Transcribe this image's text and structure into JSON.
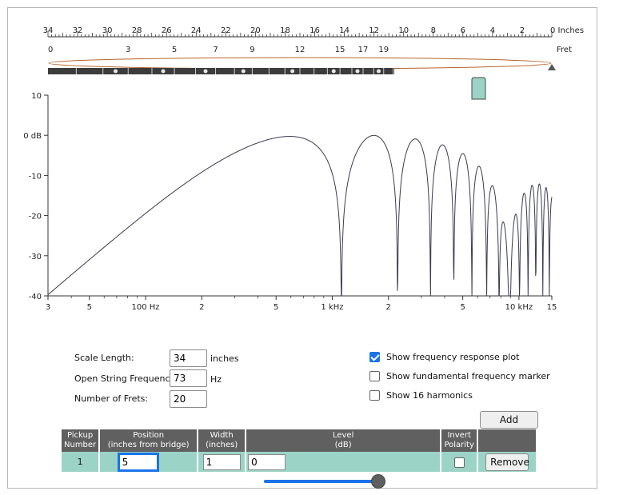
{
  "ruler": {
    "inch_labels": [
      "34",
      "32",
      "30",
      "28",
      "26",
      "24",
      "22",
      "20",
      "18",
      "16",
      "14",
      "12",
      "10",
      "8",
      "6",
      "4",
      "2",
      "0 Inches"
    ],
    "fret_labels": [
      "0",
      "3",
      "5",
      "7",
      "9",
      "12",
      "15",
      "17",
      "19"
    ],
    "fret_unit": "Fret"
  },
  "plot": {
    "y_ticks": [
      "10",
      "0 dB",
      "-10",
      "-20",
      "-30",
      "-40"
    ],
    "x_ticks": [
      "3",
      "5",
      "100 Hz",
      "2",
      "5",
      "1 kHz",
      "2",
      "5",
      "10 kHz",
      "15"
    ],
    "line_color": "#3a3a52"
  },
  "controls": {
    "scale_length_label": "Scale Length:",
    "scale_length_value": "34",
    "scale_length_unit": "inches",
    "open_freq_label": "Open String Frequency:",
    "open_freq_value": "73",
    "open_freq_unit": "Hz",
    "num_frets_label": "Number of Frets:",
    "num_frets_value": "20",
    "show_freq_response_label": "Show frequency response plot",
    "show_freq_response_checked": true,
    "show_fundamental_label": "Show fundamental frequency marker",
    "show_fundamental_checked": false,
    "show_harmonics_label": "Show 16 harmonics",
    "show_harmonics_checked": false,
    "add_pickup_label": "Add Pickup"
  },
  "pickups_table": {
    "headers": [
      {
        "line1": "Pickup",
        "line2": "Number"
      },
      {
        "line1": "Position",
        "line2": "(inches from bridge)"
      },
      {
        "line1": "Width",
        "line2": "(inches)"
      },
      {
        "line1": "Level",
        "line2": "(dB)"
      },
      {
        "line1": "Invert",
        "line2": "Polarity"
      }
    ],
    "rows": [
      {
        "number": "1",
        "position": "5",
        "width": "1",
        "level": "0",
        "invert": false,
        "remove_label": "Remove"
      }
    ]
  },
  "level_slider": {
    "value_fraction": 1.0
  },
  "colors": {
    "accent": "#1a73e8",
    "pickup_fill": "#9bd4c6",
    "table_header": "#606060",
    "string_ellipse": "#b5642a"
  }
}
